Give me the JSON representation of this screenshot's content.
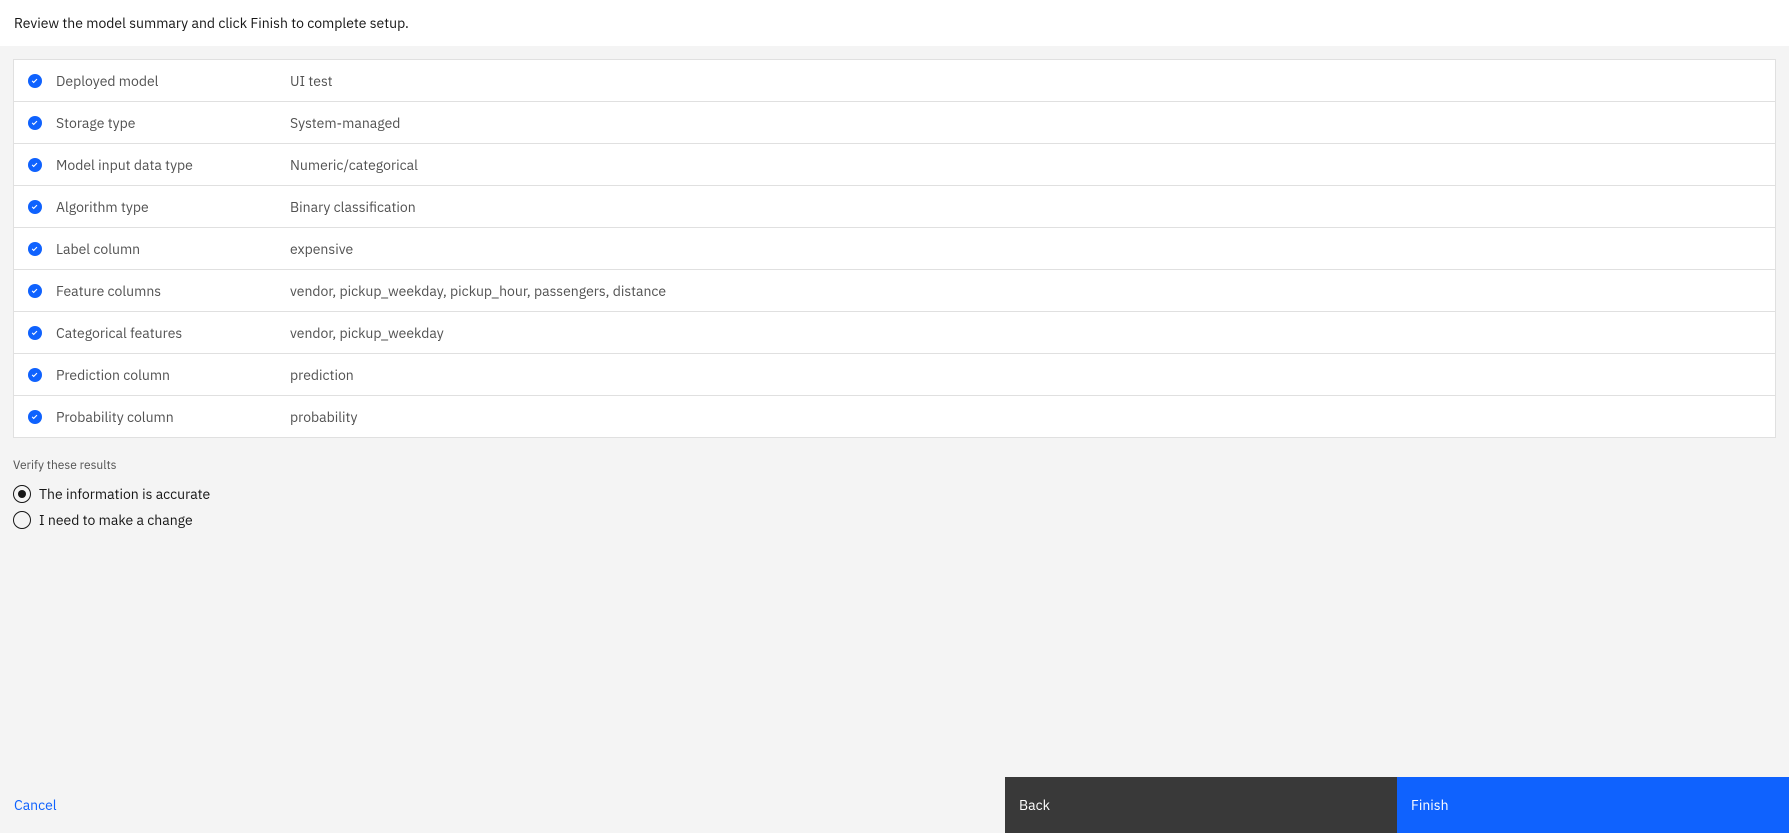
{
  "instruction": "Review the model summary and click Finish to complete setup.",
  "summary": [
    {
      "label": "Deployed model",
      "value": "UI test"
    },
    {
      "label": "Storage type",
      "value": "System-managed"
    },
    {
      "label": "Model input data type",
      "value": "Numeric/categorical"
    },
    {
      "label": "Algorithm type",
      "value": "Binary classification"
    },
    {
      "label": "Label column",
      "value": "expensive"
    },
    {
      "label": "Feature columns",
      "value": "vendor, pickup_weekday, pickup_hour, passengers, distance"
    },
    {
      "label": "Categorical features",
      "value": "vendor, pickup_weekday"
    },
    {
      "label": "Prediction column",
      "value": "prediction"
    },
    {
      "label": "Probability column",
      "value": "probability"
    }
  ],
  "verify": {
    "heading": "Verify these results",
    "options": {
      "accurate": "The information is accurate",
      "change": "I need to make a change"
    },
    "selected": "accurate"
  },
  "footer": {
    "cancel": "Cancel",
    "back": "Back",
    "finish": "Finish"
  }
}
